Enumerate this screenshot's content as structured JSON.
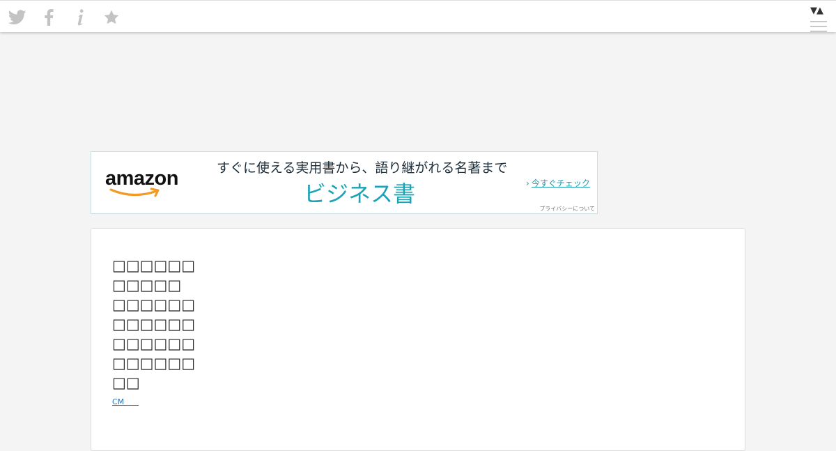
{
  "header": {
    "icons": [
      "twitter-icon",
      "facebook-icon",
      "info-icon",
      "star-icon"
    ],
    "menu_toggle": "▼▲"
  },
  "ad": {
    "logo_text": "amazon",
    "tagline": "すぐに使える実用書から、語り継がれる名著まで",
    "headline": "ビジネス書",
    "cta_chevron": "›",
    "cta": "今すぐチェック",
    "privacy": "プライバシーについて",
    "accent_color": "#1aa3b5",
    "logo_smile_color": "#f39a24"
  },
  "content": {
    "lines": [
      "□□□□□□",
      "□□□□□",
      "□□□□□□",
      "□□□□□□",
      "□□□□□□",
      "□□□□□□",
      "□□"
    ],
    "cm_link": "CM      "
  }
}
